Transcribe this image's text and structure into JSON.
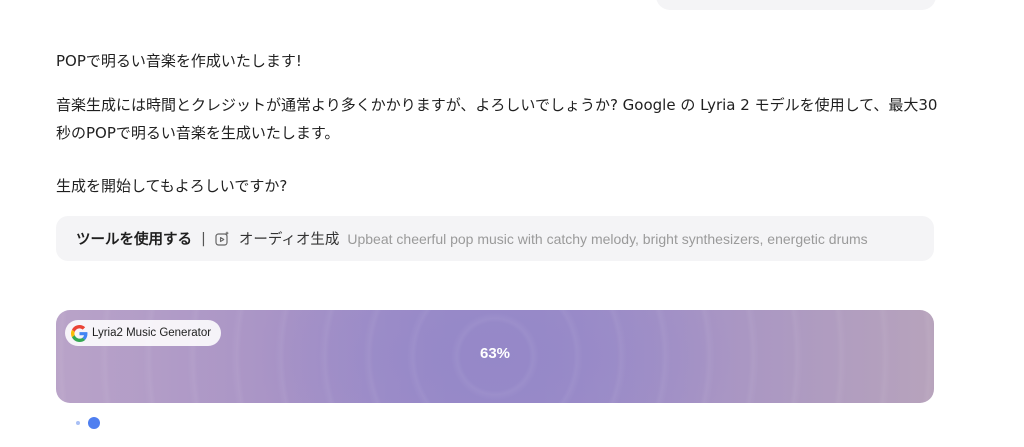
{
  "messages": [
    "POPで明るい音楽を作成いたします!",
    "音楽生成には時間とクレジットが通常より多くかかりますが、よろしいでしょうか? Google の Lyria 2 モデルを使用して、最大30秒のPOPで明るい音楽を生成いたします。",
    "生成を開始してもよろしいですか?"
  ],
  "tool_call": {
    "label": "ツールを使用する",
    "separator": "|",
    "icon": "audio-generate-icon",
    "tool_name": "オーディオ生成",
    "prompt": "Upbeat cheerful pop music with catchy melody, bright synthesizers, energetic drums"
  },
  "generator": {
    "badge_label": "Lyria2 Music Generator",
    "badge_icon": "google-g-icon",
    "progress_text": "63%",
    "progress": 0.63
  },
  "colors": {
    "accent_dot": "#4f7ff0",
    "card_center": "#9588c8",
    "card_edge": "#b9a3c8"
  }
}
